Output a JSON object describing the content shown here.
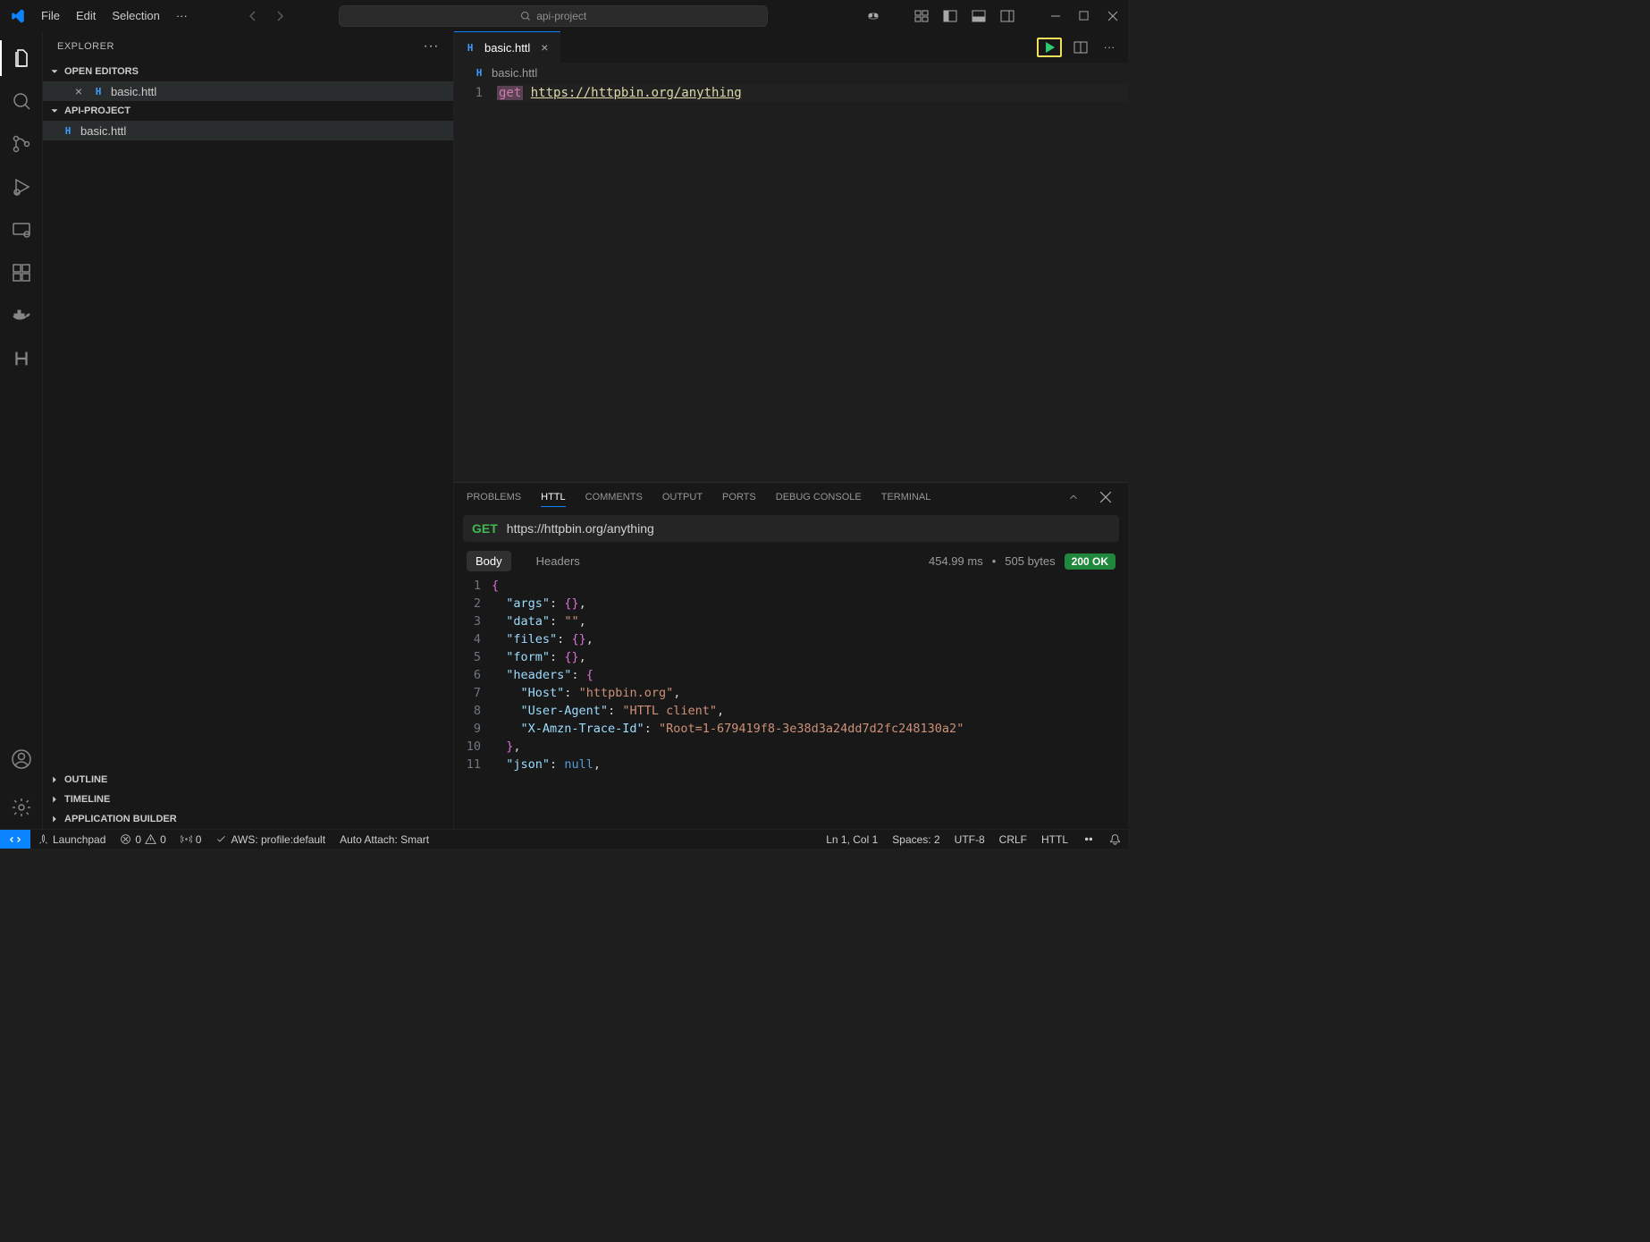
{
  "titlebar": {
    "menu": [
      "File",
      "Edit",
      "Selection"
    ],
    "search_placeholder": "api-project"
  },
  "sidebar": {
    "title": "EXPLORER",
    "sections": {
      "open_editors": "OPEN EDITORS",
      "project": "API-PROJECT",
      "outline": "OUTLINE",
      "timeline": "TIMELINE",
      "app_builder": "APPLICATION BUILDER"
    },
    "open_file": "basic.httl",
    "project_file": "basic.httl"
  },
  "editor": {
    "tab_label": "basic.httl",
    "breadcrumb": "basic.httl",
    "line_no": "1",
    "method": "get",
    "url": "https://httpbin.org/anything"
  },
  "panel": {
    "tabs": [
      "PROBLEMS",
      "HTTL",
      "COMMENTS",
      "OUTPUT",
      "PORTS",
      "DEBUG CONSOLE",
      "TERMINAL"
    ],
    "active_tab": "HTTL",
    "request": {
      "method": "GET",
      "url": "https://httpbin.org/anything"
    },
    "resp_tabs": [
      "Body",
      "Headers"
    ],
    "resp_active": "Body",
    "timing": "454.99 ms",
    "size": "505 bytes",
    "status": "200 OK",
    "json_lines": [
      [
        [
          "brace",
          "{"
        ]
      ],
      [
        [
          "punc",
          "  "
        ],
        [
          "key",
          "\"args\""
        ],
        [
          "punc",
          ": "
        ],
        [
          "brace",
          "{}"
        ],
        [
          "punc",
          ","
        ]
      ],
      [
        [
          "punc",
          "  "
        ],
        [
          "key",
          "\"data\""
        ],
        [
          "punc",
          ": "
        ],
        [
          "str",
          "\"\""
        ],
        [
          "punc",
          ","
        ]
      ],
      [
        [
          "punc",
          "  "
        ],
        [
          "key",
          "\"files\""
        ],
        [
          "punc",
          ": "
        ],
        [
          "brace",
          "{}"
        ],
        [
          "punc",
          ","
        ]
      ],
      [
        [
          "punc",
          "  "
        ],
        [
          "key",
          "\"form\""
        ],
        [
          "punc",
          ": "
        ],
        [
          "brace",
          "{}"
        ],
        [
          "punc",
          ","
        ]
      ],
      [
        [
          "punc",
          "  "
        ],
        [
          "key",
          "\"headers\""
        ],
        [
          "punc",
          ": "
        ],
        [
          "brace",
          "{"
        ]
      ],
      [
        [
          "punc",
          "    "
        ],
        [
          "key",
          "\"Host\""
        ],
        [
          "punc",
          ": "
        ],
        [
          "str",
          "\"httpbin.org\""
        ],
        [
          "punc",
          ","
        ]
      ],
      [
        [
          "punc",
          "    "
        ],
        [
          "key",
          "\"User-Agent\""
        ],
        [
          "punc",
          ": "
        ],
        [
          "str",
          "\"HTTL client\""
        ],
        [
          "punc",
          ","
        ]
      ],
      [
        [
          "punc",
          "    "
        ],
        [
          "key",
          "\"X-Amzn-Trace-Id\""
        ],
        [
          "punc",
          ": "
        ],
        [
          "str",
          "\"Root=1-679419f8-3e38d3a24dd7d2fc248130a2\""
        ]
      ],
      [
        [
          "punc",
          "  "
        ],
        [
          "brace",
          "}"
        ],
        [
          "punc",
          ","
        ]
      ],
      [
        [
          "punc",
          "  "
        ],
        [
          "key",
          "\"json\""
        ],
        [
          "punc",
          ": "
        ],
        [
          "kw",
          "null"
        ],
        [
          "punc",
          ","
        ]
      ]
    ]
  },
  "statusbar": {
    "launchpad": "Launchpad",
    "errors": "0",
    "warnings": "0",
    "ports": "0",
    "aws": "AWS: profile:default",
    "auto_attach": "Auto Attach: Smart",
    "ln_col": "Ln 1, Col 1",
    "spaces": "Spaces: 2",
    "encoding": "UTF-8",
    "eol": "CRLF",
    "lang": "HTTL"
  }
}
